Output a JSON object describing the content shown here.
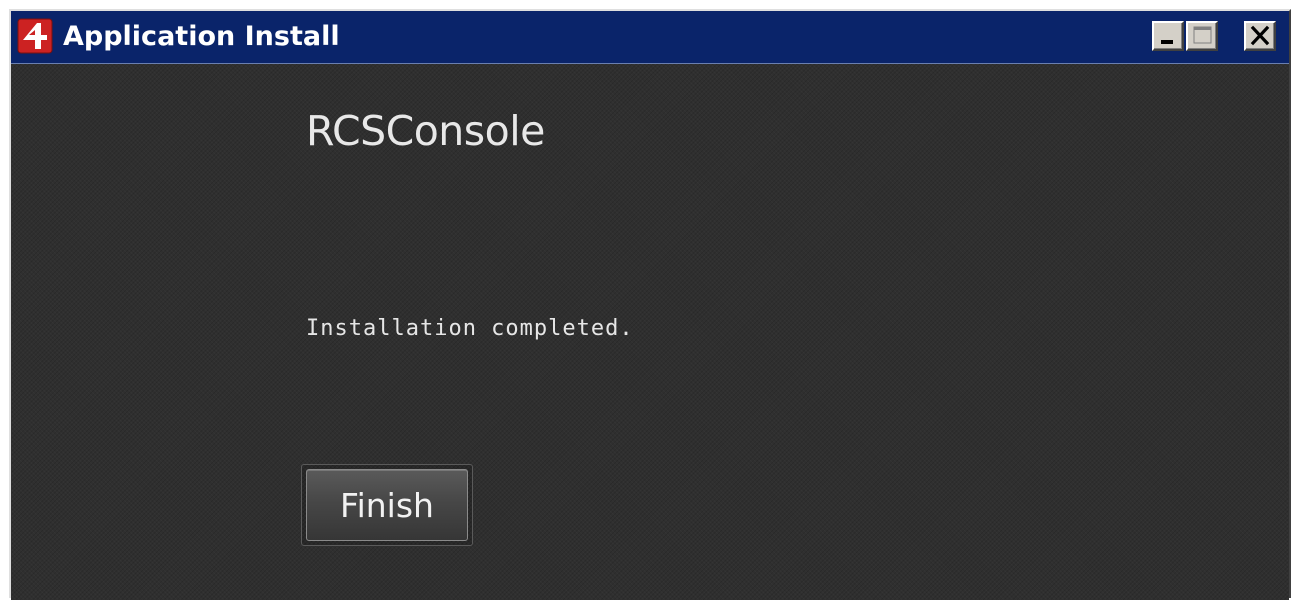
{
  "window": {
    "title": "Application Install",
    "icon": "adobe-air-icon",
    "controls": {
      "minimize": "minimize-icon",
      "maximize": "maximize-icon",
      "close": "close-icon"
    }
  },
  "main": {
    "app_name": "RCSConsole",
    "status": "Installation completed.",
    "finish_label": "Finish"
  },
  "colors": {
    "titlebar": "#0a246a",
    "content_bg": "#2f2f2f",
    "icon_red": "#cc2222"
  }
}
